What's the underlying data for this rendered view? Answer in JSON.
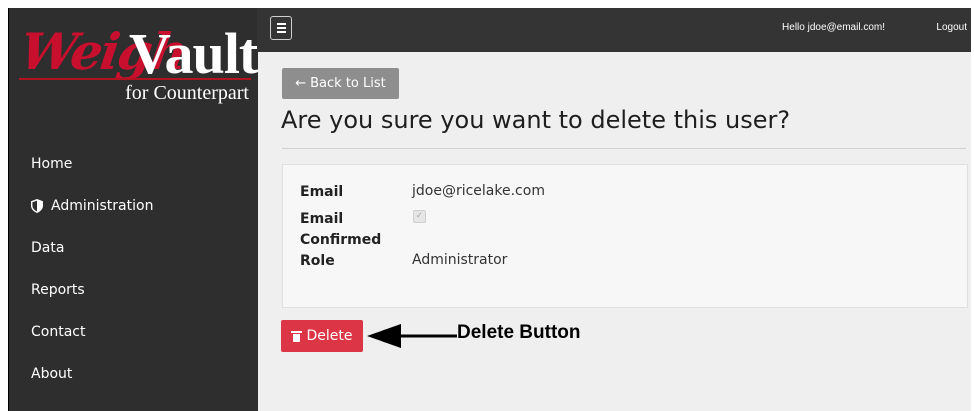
{
  "logo": {
    "weigh": "Weigh",
    "vault": "Vault",
    "tagline": "for Counterpart"
  },
  "sidebar": {
    "items": [
      {
        "label": "Home"
      },
      {
        "label": "Administration",
        "icon": "shield-icon"
      },
      {
        "label": "Data"
      },
      {
        "label": "Reports"
      },
      {
        "label": "Contact"
      },
      {
        "label": "About"
      }
    ]
  },
  "topbar": {
    "greeting": "Hello jdoe@email.com!",
    "logout": "Logout"
  },
  "back_button": {
    "label": "Back to List",
    "icon": "arrow-left-icon"
  },
  "page_title": "Are you sure you want to delete this user?",
  "details": {
    "email_label": "Email",
    "email_value": "jdoe@ricelake.com",
    "confirmed_label_1": "Email",
    "confirmed_label_2": "Confirmed",
    "confirmed_value": true,
    "role_label": "Role",
    "role_value": "Administrator"
  },
  "delete_button": {
    "label": "Delete",
    "icon": "trash-icon",
    "color": "#dc3545"
  },
  "annotation": {
    "label": "Delete Button"
  },
  "colors": {
    "sidebar": "#2e2e2e",
    "topbar": "#343434",
    "content_bg": "#efefef",
    "brand_red": "#c8102e",
    "back_button": "#8e8e8e"
  }
}
